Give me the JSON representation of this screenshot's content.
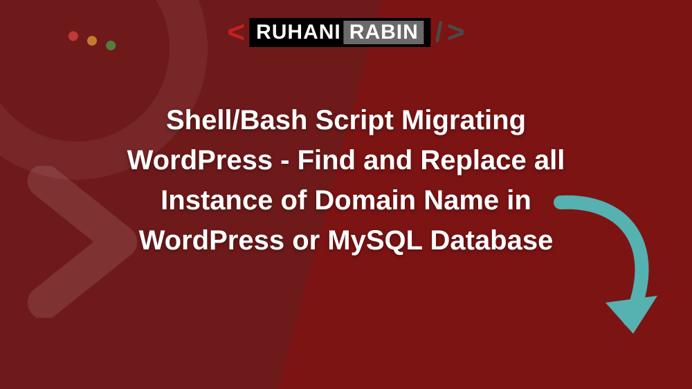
{
  "logo": {
    "angle_open": "<",
    "brand_white": "RUHANI",
    "brand_gray": "RABIN",
    "slash": "/",
    "angle_close": ">"
  },
  "title": "Shell/Bash Script Migrating WordPress - Find and Replace all Instance of Domain Name in WordPress or MySQL Database",
  "colors": {
    "arrow": "#56b1b1"
  }
}
